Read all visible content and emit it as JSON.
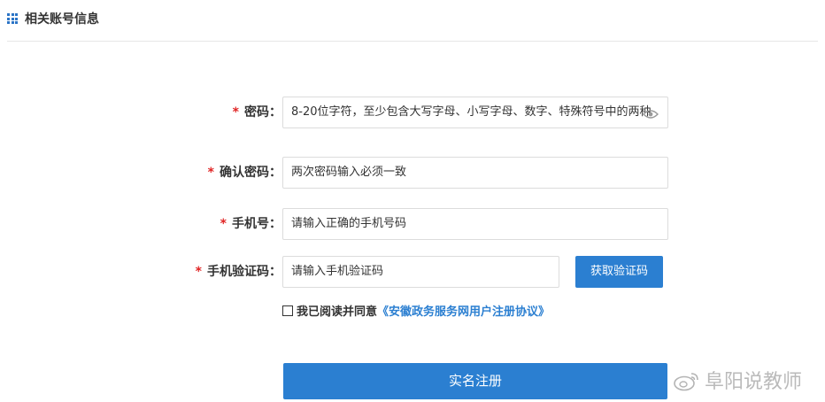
{
  "section": {
    "title": "相关账号信息",
    "icon": "grid-icon"
  },
  "form": {
    "required_mark": "*",
    "password": {
      "label": "密码：",
      "placeholder": "8-20位字符，至少包含大写字母、小写字母、数字、特殊符号中的两种",
      "icon": "eye-icon"
    },
    "confirm_password": {
      "label": "确认密码：",
      "placeholder": "两次密码输入必须一致"
    },
    "phone": {
      "label": "手机号：",
      "placeholder": "请输入正确的手机号码"
    },
    "sms_code": {
      "label": "手机验证码：",
      "placeholder": "请输入手机验证码",
      "button_label": "获取验证码"
    },
    "agreement": {
      "text": "我已阅读并同意",
      "link": "《安徽政务服务网用户注册协议》",
      "checked": false
    },
    "submit_label": "实名注册"
  },
  "watermark": {
    "text": "阜阳说教师",
    "icon": "weibo-icon"
  },
  "colors": {
    "accent": "#2b7fd1",
    "required": "#e02424",
    "border": "#dcdcdc"
  }
}
